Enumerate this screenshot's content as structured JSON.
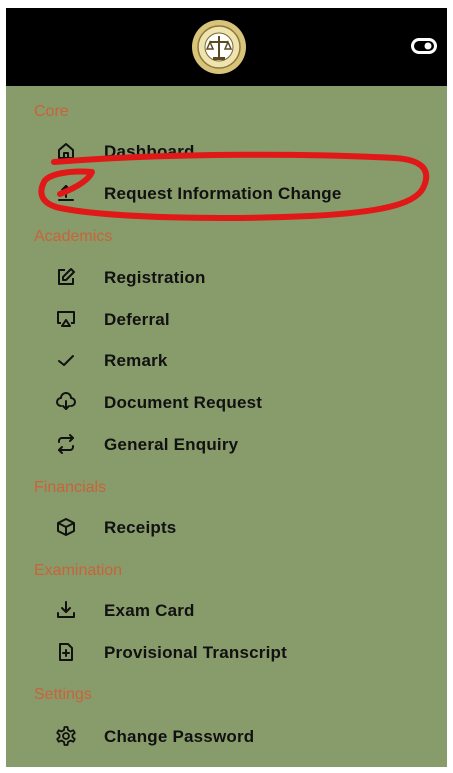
{
  "header": {
    "logo_icon": "crest-logo-icon",
    "toggle_icon": "toggle-icon"
  },
  "sections": {
    "core": "Core",
    "academics": "Academics",
    "financials": "Financials",
    "examination": "Examination",
    "settings": "Settings"
  },
  "items": {
    "dashboard": {
      "label": "Dashboard",
      "icon": "home-icon"
    },
    "request_change": {
      "label": "Request Information Change",
      "icon": "upload-arrow-icon"
    },
    "registration": {
      "label": "Registration",
      "icon": "edit-icon"
    },
    "deferral": {
      "label": "Deferral",
      "icon": "cast-icon"
    },
    "remark": {
      "label": "Remark",
      "icon": "check-icon"
    },
    "document_request": {
      "label": "Document Request",
      "icon": "cloud-download-icon"
    },
    "general_enquiry": {
      "label": "General Enquiry",
      "icon": "repeat-icon"
    },
    "receipts": {
      "label": "Receipts",
      "icon": "box-icon"
    },
    "exam_card": {
      "label": "Exam Card",
      "icon": "download-icon"
    },
    "provisional_transcript": {
      "label": "Provisional Transcript",
      "icon": "file-plus-icon"
    },
    "change_password": {
      "label": "Change Password",
      "icon": "gear-icon"
    }
  },
  "colors": {
    "sidebar_bg": "#889b6a",
    "header_bg": "#000000",
    "section_text": "#c9633a",
    "annotation": "#e01818"
  }
}
